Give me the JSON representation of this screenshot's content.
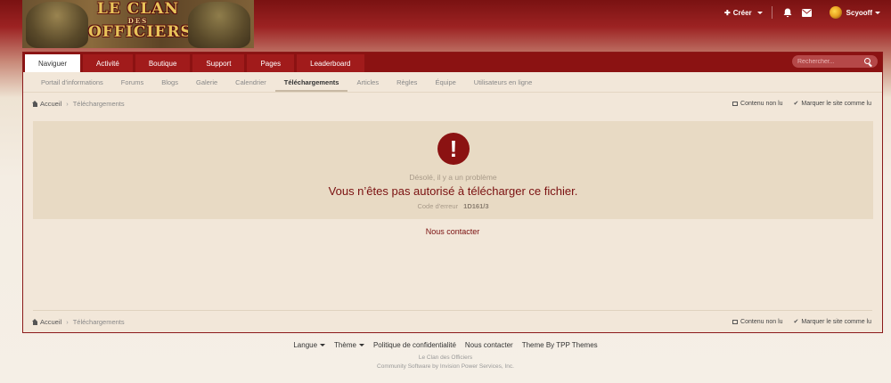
{
  "logo": {
    "line1": "LE CLAN",
    "line2": "DES",
    "line3": "OFFICIERS"
  },
  "user_bar": {
    "create_label": "Créer",
    "username": "Scyooff"
  },
  "nav_primary": {
    "tabs": [
      {
        "label": "Naviguer",
        "active": true
      },
      {
        "label": "Activité"
      },
      {
        "label": "Boutique"
      },
      {
        "label": "Support"
      },
      {
        "label": "Pages"
      },
      {
        "label": "Leaderboard"
      }
    ],
    "search_placeholder": "Rechercher..."
  },
  "nav_secondary": {
    "items": [
      "Portail d'informations",
      "Forums",
      "Blogs",
      "Galerie",
      "Calendrier",
      "Téléchargements",
      "Articles",
      "Règles",
      "Équipe",
      "Utilisateurs en ligne"
    ],
    "active_index": 5
  },
  "breadcrumb": {
    "home": "Accueil",
    "current": "Téléchargements"
  },
  "crumb_actions": {
    "unread": "Contenu non lu",
    "mark_read": "Marquer le site comme lu"
  },
  "error": {
    "subtitle": "Désolé, il y a un problème",
    "message": "Vous n’êtes pas autorisé à télécharger ce fichier.",
    "code_label": "Code d'erreur",
    "code": "1D161/3"
  },
  "contact_link": "Nous contacter",
  "footer": {
    "links": {
      "language": "Langue",
      "theme": "Thème",
      "privacy": "Politique de confidentialité",
      "contact": "Nous contacter",
      "theme_by": "Theme By TPP Themes"
    },
    "site_name": "Le Clan des Officiers",
    "powered": "Community Software by Invision Power Services, Inc."
  },
  "colors": {
    "accent": "#8b1212",
    "tab": "#a11b1b",
    "panel_bg": "#f2e7d9",
    "error_bg": "#e8dac4",
    "error_text": "#7a1010"
  }
}
